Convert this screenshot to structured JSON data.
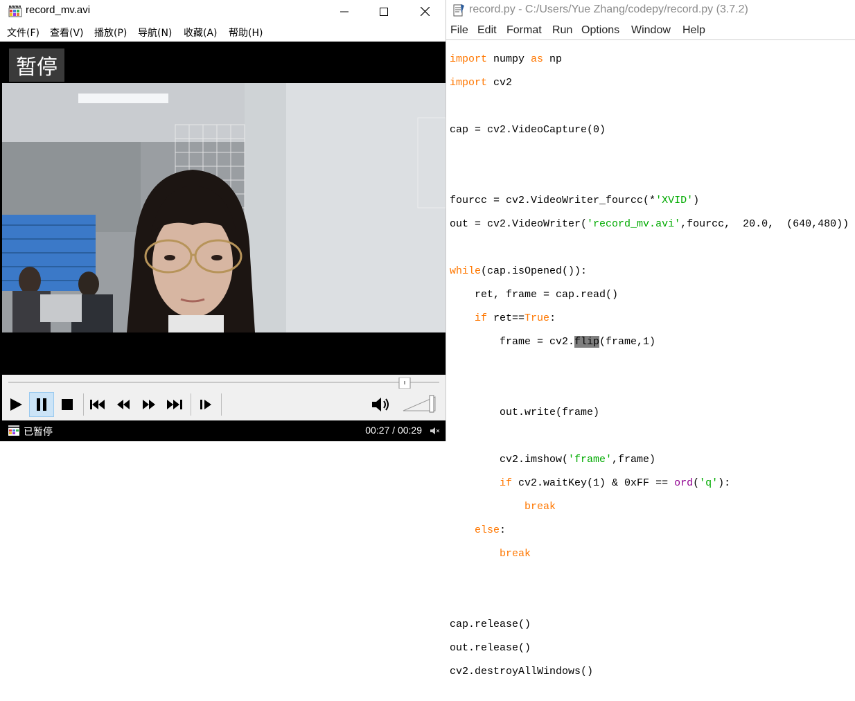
{
  "player": {
    "title": "record_mv.avi",
    "menu": [
      "文件(F)",
      "查看(V)",
      "播放(P)",
      "导航(N)",
      "收藏(A)",
      "帮助(H)"
    ],
    "osd_text": "暂停",
    "status_text": "已暂停",
    "time_text": "00:27 / 00:29",
    "seek_progress": 0.93,
    "volume_level": 0.95
  },
  "editor": {
    "title": "record.py - C:/Users/Yue Zhang/codepy/record.py (3.7.2)",
    "menu": [
      "File",
      "Edit",
      "Format",
      "Run",
      "Options",
      "Window",
      "Help"
    ],
    "code": {
      "l1_kw": "import",
      "l1_rest": " numpy ",
      "l1_as": "as",
      "l1_np": " np",
      "l2_kw": "import",
      "l2_rest": " cv2",
      "l4": "cap = cv2.VideoCapture(0)",
      "l7_a": "fourcc = cv2.VideoWriter_fourcc(*",
      "l7_s": "'XVID'",
      "l7_b": ")",
      "l8_a": "out = cv2.VideoWriter(",
      "l8_s": "'record_mv.avi'",
      "l8_b": ",fourcc,  20.0,  (640,480))",
      "l10_kw": "while",
      "l10_rest": "(cap.isOpened()):",
      "l11": "    ret, frame = cap.read()",
      "l12_ind": "    ",
      "l12_kw": "if",
      "l12_a": " ret==",
      "l12_true": "True",
      "l12_b": ":",
      "l13_a": "        frame = cv2.",
      "l13_sel": "flip",
      "l13_b": "(frame,1)",
      "l16": "        out.write(frame)",
      "l18_a": "        cv2.imshow(",
      "l18_s": "'frame'",
      "l18_b": ",frame)",
      "l19_ind": "        ",
      "l19_kw": "if",
      "l19_a": " cv2.waitKey(1) & 0xFF == ",
      "l19_ord": "ord",
      "l19_b": "(",
      "l19_s": "'q'",
      "l19_c": "):",
      "l20_ind": "            ",
      "l20_kw": "break",
      "l21_ind": "    ",
      "l21_kw": "else",
      "l21_b": ":",
      "l22_ind": "        ",
      "l22_kw": "break",
      "l25": "cap.release()",
      "l26": "out.release()",
      "l27": "cv2.destroyAllWindows()"
    }
  },
  "colors": {
    "keyword": "#ff7700",
    "string": "#00aa00",
    "builtin": "#900090",
    "selection": "#7f7f7f",
    "pause_active": "#cce4f7"
  }
}
